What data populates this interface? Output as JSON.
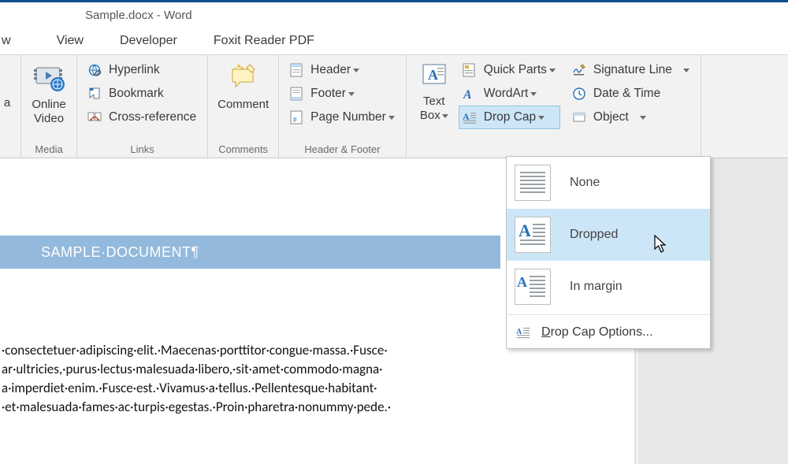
{
  "title": "Sample.docx - Word",
  "tabs": [
    "w",
    "View",
    "Developer",
    "Foxit Reader PDF"
  ],
  "ribbon": {
    "online_video": "Online\nVideo",
    "media_group": "Media",
    "links": {
      "hyperlink": "Hyperlink",
      "bookmark": "Bookmark",
      "crossref": "Cross-reference",
      "group": "Links"
    },
    "comment": "Comment",
    "comments_group": "Comments",
    "hf": {
      "header": "Header",
      "footer": "Footer",
      "pagenum": "Page Number",
      "group": "Header & Footer"
    },
    "textbox": "Text\nBox",
    "text": {
      "quickparts": "Quick Parts",
      "wordart": "WordArt",
      "dropcap": "Drop Cap",
      "sigline": "Signature Line",
      "datetime": "Date & Time",
      "object": "Object"
    }
  },
  "dropcap_menu": {
    "none": "None",
    "dropped": "Dropped",
    "inmargin": "In margin",
    "options": "Drop Cap Options..."
  },
  "doc": {
    "heading": "SAMPLE·DOCUMENT¶",
    "body": "·consectetuer·adipiscing·elit.·Maecenas·porttitor·congue·massa.·Fusce·\nar·ultricies,·purus·lectus·malesuada·libero,·sit·amet·commodo·magna·\na·imperdiet·enim.·Fusce·est.·Vivamus·a·tellus.·Pellentesque·habitant·\n·et·malesuada·fames·ac·turpis·egestas.·Proin·pharetra·nonummy·pede.·"
  }
}
